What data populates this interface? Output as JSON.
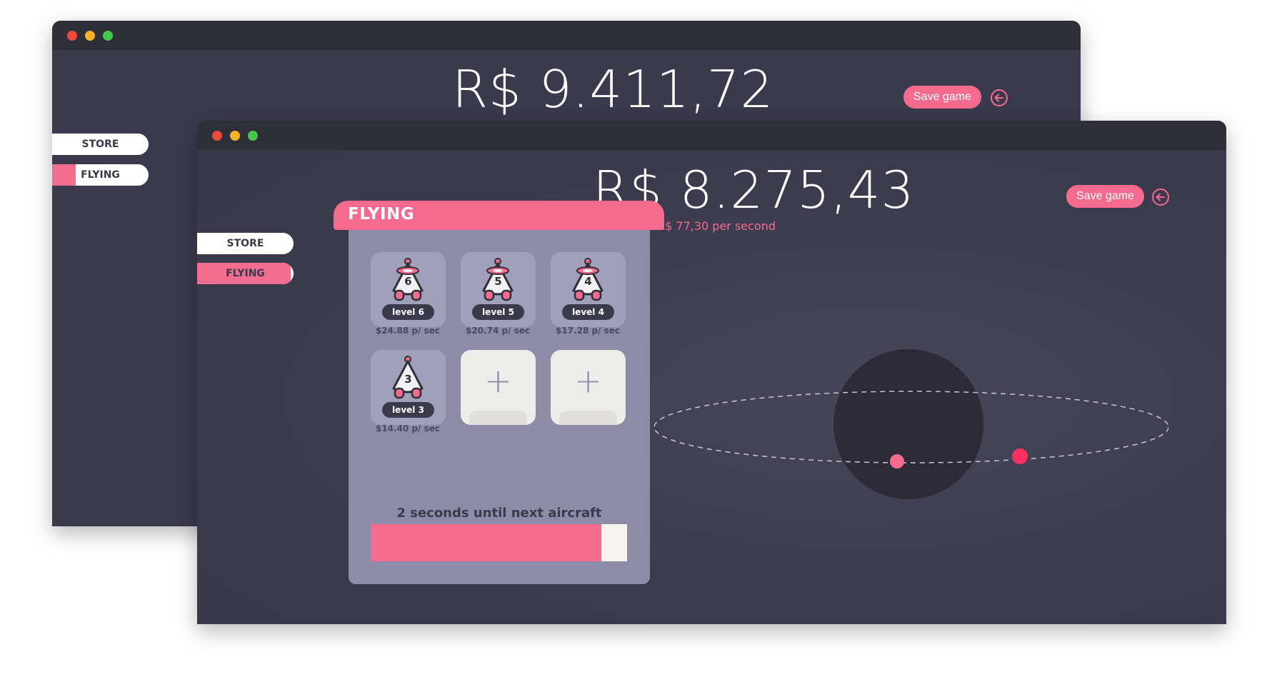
{
  "back_window": {
    "money": "R$ 9.411,72",
    "save_label": "Save game",
    "nav": {
      "store_label": "STORE",
      "flying_label": "FLYING"
    }
  },
  "front_window": {
    "money": "R$ 8.275,43",
    "rate": "R$ 77,30 per second",
    "save_label": "Save game",
    "nav": {
      "store_label": "STORE",
      "flying_label": "FLYING"
    }
  },
  "flying": {
    "title": "FLYING",
    "aircraft": [
      {
        "number": "6",
        "level": "level 6",
        "rate": "$24.88 p/ sec"
      },
      {
        "number": "5",
        "level": "level 5",
        "rate": "$20.74 p/ sec"
      },
      {
        "number": "4",
        "level": "level 4",
        "rate": "$17.28 p/ sec"
      },
      {
        "number": "3",
        "level": "level 3",
        "rate": "$14.40 p/ sec"
      }
    ],
    "empty_slot_symbol": "+",
    "countdown": "2 seconds until next aircraft",
    "progress_fraction": 0.9
  },
  "icons": {
    "back": "arrow-left-circle-icon",
    "aircraft": "rocket-ship-icon",
    "add": "plus-icon"
  },
  "colors": {
    "accent": "#f46b8f",
    "window_bg": "#3b3a4d",
    "titlebar": "#2f2f38",
    "panel_bg": "#8e8ba8",
    "planet": "#2c2b37",
    "orbit_dot": "#ff2f63"
  }
}
